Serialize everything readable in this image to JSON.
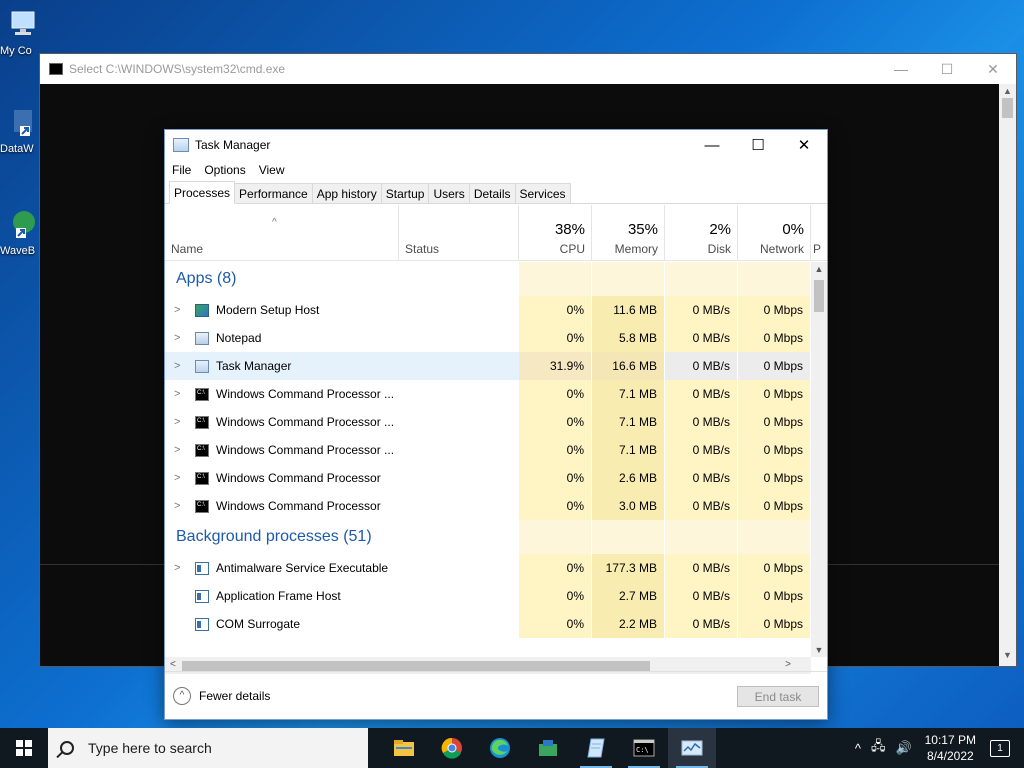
{
  "desktop": {
    "icons": [
      {
        "label": "My Co",
        "icon": "computer-icon"
      },
      {
        "label": "DataW",
        "icon": "shortcut-icon"
      },
      {
        "label": "WaveB",
        "icon": "shortcut-icon"
      }
    ]
  },
  "cmd_window": {
    "title": "Select C:\\WINDOWS\\system32\\cmd.exe",
    "minimize": "—",
    "maximize": "☐",
    "close": "✕"
  },
  "task_manager": {
    "title": "Task Manager",
    "minimize": "—",
    "maximize": "☐",
    "close": "✕",
    "menu": [
      "File",
      "Options",
      "View"
    ],
    "tabs": [
      "Processes",
      "Performance",
      "App history",
      "Startup",
      "Users",
      "Details",
      "Services"
    ],
    "active_tab": "Processes",
    "columns": {
      "name": "Name",
      "status": "Status",
      "cpu": {
        "pct": "38%",
        "label": "CPU"
      },
      "memory": {
        "pct": "35%",
        "label": "Memory"
      },
      "disk": {
        "pct": "2%",
        "label": "Disk"
      },
      "network": {
        "pct": "0%",
        "label": "Network"
      },
      "power": "P"
    },
    "groups": [
      {
        "title": "Apps (8)",
        "rows": [
          {
            "name": "Modern Setup Host",
            "icon": "setup-icon",
            "cpu": "0%",
            "mem": "11.6 MB",
            "disk": "0 MB/s",
            "net": "0 Mbps",
            "expand": true
          },
          {
            "name": "Notepad",
            "icon": "notepad-icon",
            "cpu": "0%",
            "mem": "5.8 MB",
            "disk": "0 MB/s",
            "net": "0 Mbps",
            "expand": true
          },
          {
            "name": "Task Manager",
            "icon": "task-manager-icon",
            "cpu": "31.9%",
            "mem": "16.6 MB",
            "disk": "0 MB/s",
            "net": "0 Mbps",
            "expand": true,
            "selected": true
          },
          {
            "name": "Windows Command Processor ...",
            "icon": "cmd-icon",
            "cpu": "0%",
            "mem": "7.1 MB",
            "disk": "0 MB/s",
            "net": "0 Mbps",
            "expand": true
          },
          {
            "name": "Windows Command Processor ...",
            "icon": "cmd-icon",
            "cpu": "0%",
            "mem": "7.1 MB",
            "disk": "0 MB/s",
            "net": "0 Mbps",
            "expand": true
          },
          {
            "name": "Windows Command Processor ...",
            "icon": "cmd-icon",
            "cpu": "0%",
            "mem": "7.1 MB",
            "disk": "0 MB/s",
            "net": "0 Mbps",
            "expand": true
          },
          {
            "name": "Windows Command Processor",
            "icon": "cmd-icon",
            "cpu": "0%",
            "mem": "2.6 MB",
            "disk": "0 MB/s",
            "net": "0 Mbps",
            "expand": true
          },
          {
            "name": "Windows Command Processor",
            "icon": "cmd-icon",
            "cpu": "0%",
            "mem": "3.0 MB",
            "disk": "0 MB/s",
            "net": "0 Mbps",
            "expand": true
          }
        ]
      },
      {
        "title": "Background processes (51)",
        "rows": [
          {
            "name": "Antimalware Service Executable",
            "icon": "service-icon",
            "cpu": "0%",
            "mem": "177.3 MB",
            "disk": "0 MB/s",
            "net": "0 Mbps",
            "expand": true
          },
          {
            "name": "Application Frame Host",
            "icon": "service-icon",
            "cpu": "0%",
            "mem": "2.7 MB",
            "disk": "0 MB/s",
            "net": "0 Mbps",
            "expand": false
          },
          {
            "name": "COM Surrogate",
            "icon": "service-icon",
            "cpu": "0%",
            "mem": "2.2 MB",
            "disk": "0 MB/s",
            "net": "0 Mbps",
            "expand": false
          }
        ]
      }
    ],
    "fewer_details": "Fewer details",
    "end_task": "End task"
  },
  "taskbar": {
    "search_placeholder": "Type here to search",
    "apps": [
      "file-explorer-icon",
      "chrome-icon",
      "edge-icon",
      "setup-icon",
      "notepad-icon",
      "cmd-icon",
      "task-manager-icon"
    ],
    "tray": {
      "chevron": "^",
      "network": "🖧",
      "volume": "🔊"
    },
    "time": "10:17 PM",
    "date": "8/4/2022",
    "notifications": "1"
  },
  "colors": {
    "accent": "#1e5aa8",
    "cpu_heat": "#fff4c4",
    "selected_row": "#e5f1fb"
  }
}
